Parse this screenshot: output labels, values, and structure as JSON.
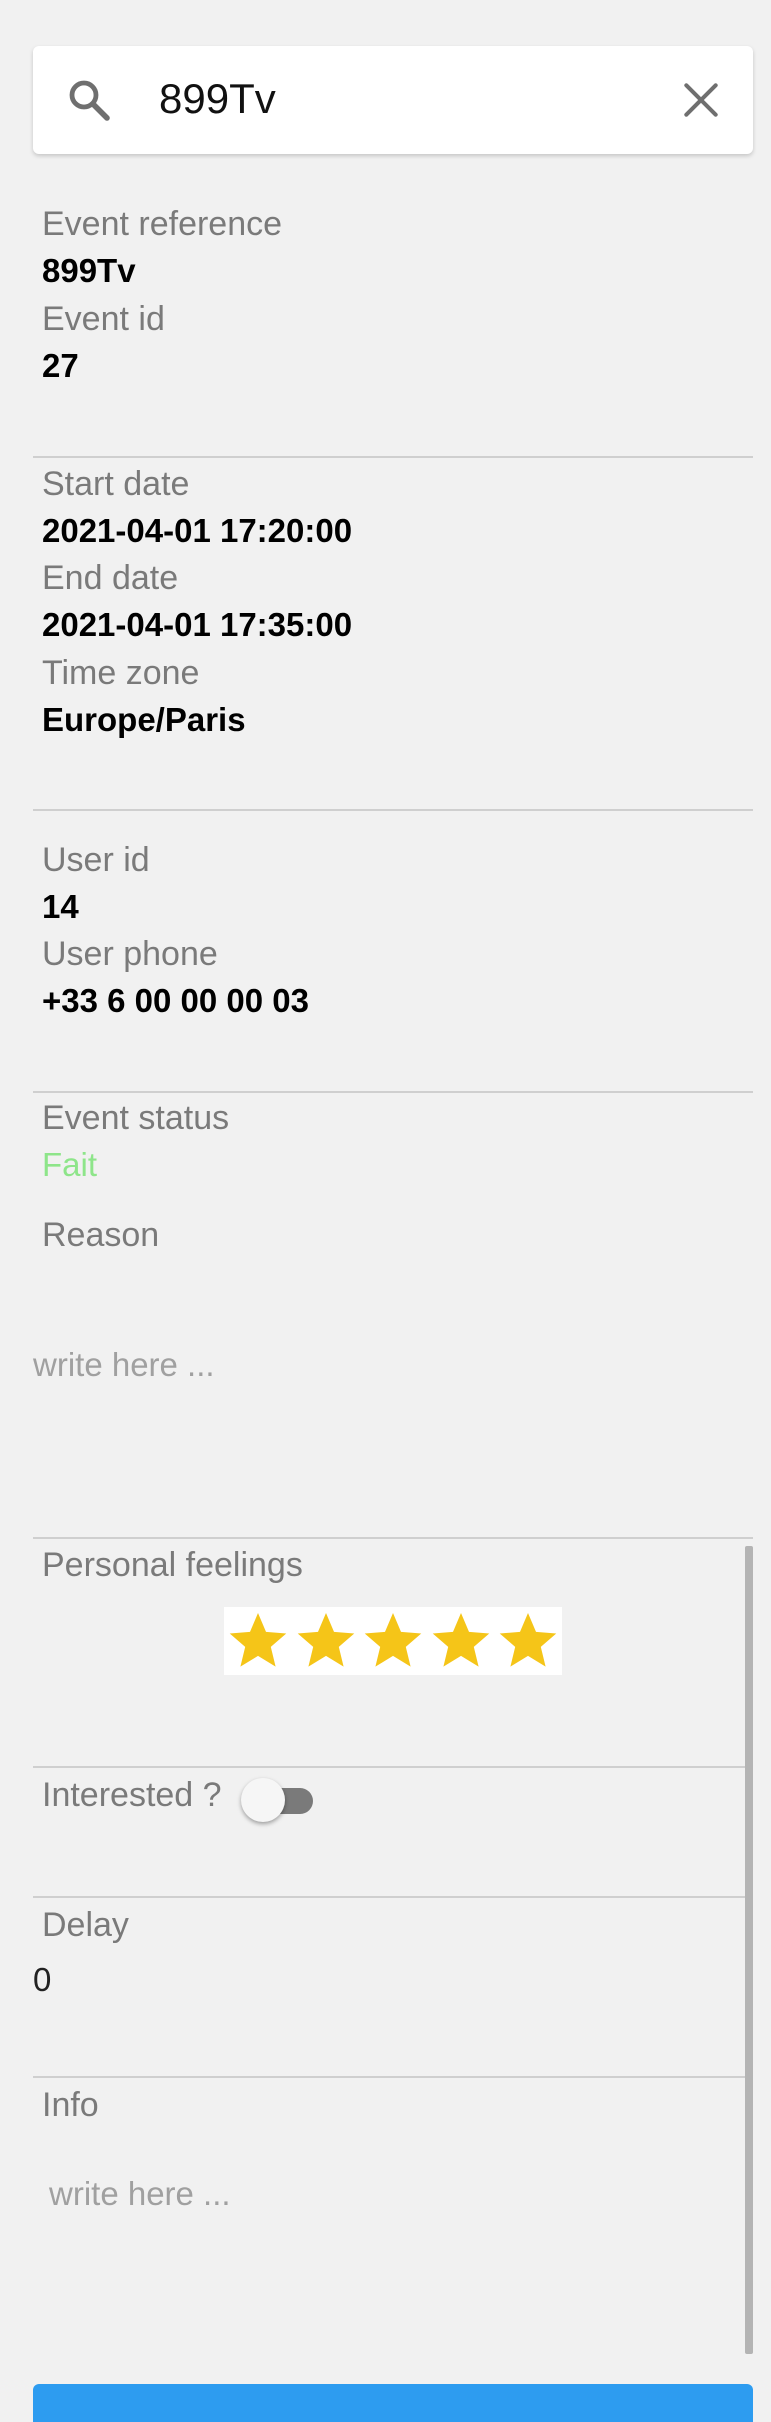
{
  "search": {
    "value": "899Tv",
    "search_icon": "search-icon",
    "clear_icon": "close-icon"
  },
  "event": {
    "reference_label": "Event reference",
    "reference_value": "899Tv",
    "id_label": "Event id",
    "id_value": "27"
  },
  "dates": {
    "start_label": "Start date",
    "start_value": "2021-04-01 17:20:00",
    "end_label": "End date",
    "end_value": "2021-04-01 17:35:00",
    "tz_label": "Time zone",
    "tz_value": "Europe/Paris"
  },
  "user": {
    "id_label": "User id",
    "id_value": "14",
    "phone_label": "User phone",
    "phone_value": "+33 6 00 00 00 03"
  },
  "status": {
    "label": "Event status",
    "value": "Fait",
    "value_color": "#8ee58a",
    "reason_label": "Reason",
    "reason_placeholder": "write here ..."
  },
  "feelings": {
    "label": "Personal feelings",
    "rating": 5,
    "max": 5,
    "star_color": "#f5c518"
  },
  "interested": {
    "label": "Interested ?",
    "on": false
  },
  "delay": {
    "label": "Delay",
    "value": "0"
  },
  "info": {
    "label": "Info",
    "placeholder": "write here ..."
  },
  "colors": {
    "accent": "#2d9cf0"
  }
}
